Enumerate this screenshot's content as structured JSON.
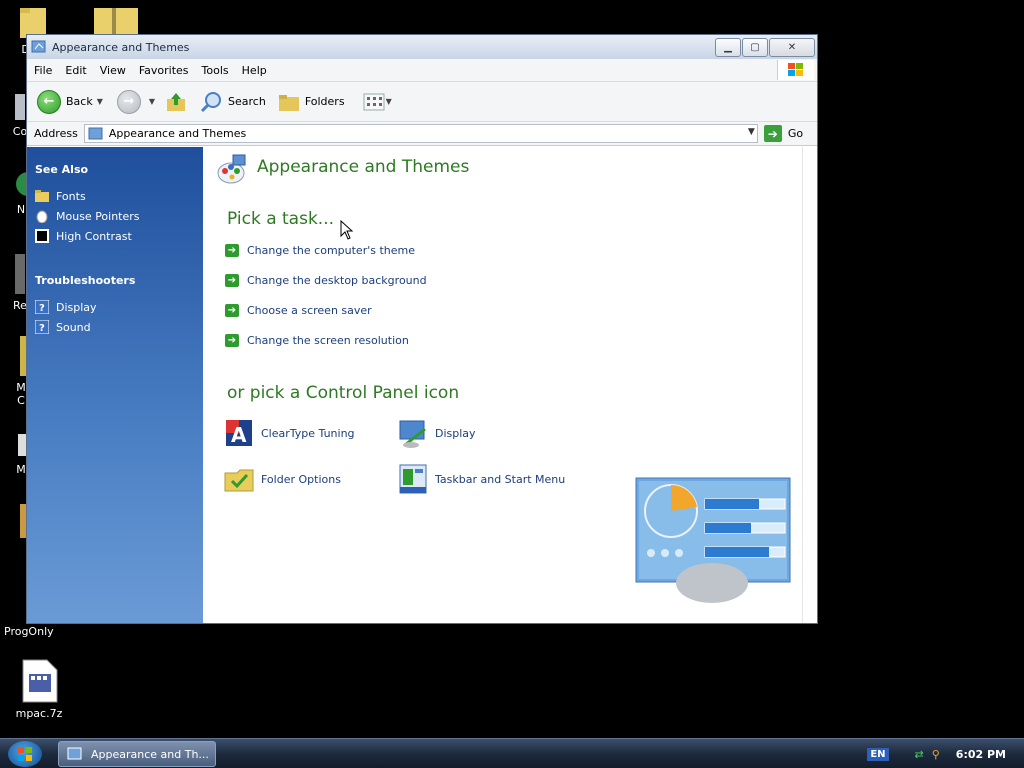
{
  "desktop": {
    "icons": [
      {
        "label": "Do"
      },
      {
        "label": "Co"
      },
      {
        "label": "N"
      },
      {
        "label": "Re"
      },
      {
        "label": "M\nC"
      },
      {
        "label": "M"
      },
      {
        "label": "ProgOnly"
      },
      {
        "label": "mpac.7z"
      }
    ]
  },
  "window": {
    "title": "Appearance and Themes",
    "menu": [
      "File",
      "Edit",
      "View",
      "Favorites",
      "Tools",
      "Help"
    ],
    "toolbar": {
      "back_label": "Back",
      "search_label": "Search",
      "folders_label": "Folders"
    },
    "address": {
      "label": "Address",
      "value": "Appearance and Themes",
      "go_label": "Go"
    },
    "sidebar": {
      "see_also_title": "See Also",
      "see_also": [
        "Fonts",
        "Mouse Pointers",
        "High Contrast"
      ],
      "troubleshooters_title": "Troubleshooters",
      "troubleshooters": [
        "Display",
        "Sound"
      ]
    },
    "main": {
      "heading": "Appearance and Themes",
      "pick_task": "Pick a task...",
      "tasks": [
        "Change the computer's theme",
        "Change the desktop background",
        "Choose a screen saver",
        "Change the screen resolution"
      ],
      "or_pick": "or pick a Control Panel icon",
      "icons": [
        "ClearType Tuning",
        "Display",
        "Folder Options",
        "Taskbar and Start Menu"
      ]
    }
  },
  "taskbar": {
    "task_label": "Appearance and Th...",
    "lang": "EN",
    "clock": "6:02 PM"
  }
}
